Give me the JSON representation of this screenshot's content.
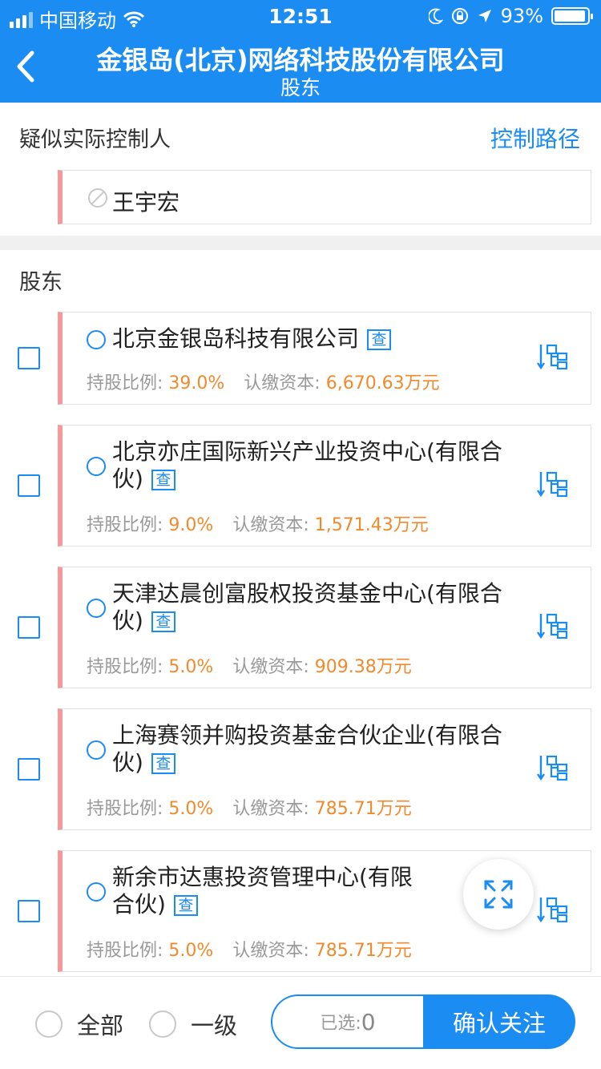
{
  "status_bar": {
    "carrier": "中国移动",
    "time": "12:51",
    "battery": "93%"
  },
  "header": {
    "title": "金银岛(北京)网络科技股份有限公司",
    "subtitle": "股东"
  },
  "controller_section": {
    "heading": "疑似实际控制人",
    "link": "控制路径",
    "person": "王宇宏"
  },
  "shareholder_section": {
    "heading": "股东"
  },
  "labels": {
    "ratio": "持股比例: ",
    "capital": "认缴资本: ",
    "lookup_badge": "查"
  },
  "shareholders": [
    {
      "name": "北京金银岛科技有限公司",
      "ratio": "39.0%",
      "capital": "6,670.63万元"
    },
    {
      "name": "北京亦庄国际新兴产业投资中心(有限合伙)",
      "ratio": "9.0%",
      "capital": "1,571.43万元"
    },
    {
      "name": "天津达晨创富股权投资基金中心(有限合伙)",
      "ratio": "5.0%",
      "capital": "909.38万元"
    },
    {
      "name": "上海赛领并购投资基金合伙企业(有限合伙)",
      "ratio": "5.0%",
      "capital": "785.71万元"
    },
    {
      "name": "新余市达惠投资管理中心(有限合伙)",
      "ratio": "5.0%",
      "capital": "785.71万元"
    }
  ],
  "bottom_bar": {
    "option_all": "全部",
    "option_level1": "一级",
    "selected_label": "已选:",
    "selected_count": "0",
    "confirm_label": "确认关注"
  },
  "colors": {
    "primary": "#1a8cf2",
    "accent_bar": "#f59a9a",
    "value": "#f08a2c"
  }
}
